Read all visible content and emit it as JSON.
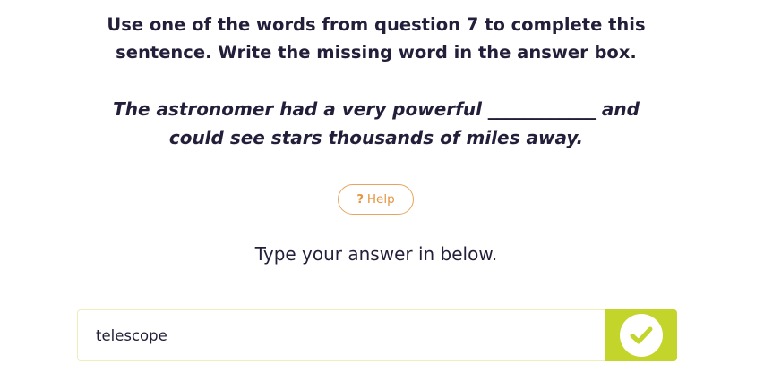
{
  "question": {
    "instruction_line1": "Use one of the words from question 7 to complete this",
    "instruction_line2": "sentence. Write the missing word in the answer box.",
    "sentence_line1": "The astronomer had a very powerful ____________ and",
    "sentence_line2": "could see stars thousands of miles away."
  },
  "help": {
    "icon": "?",
    "label": "Help"
  },
  "answer": {
    "prompt": "Type your answer in below.",
    "value": "telescope",
    "submit_icon": "check-icon"
  },
  "colors": {
    "text": "#231f3a",
    "help_accent": "#e8a45e",
    "submit_bg": "#c3d52b",
    "input_border": "#eef0b8"
  }
}
